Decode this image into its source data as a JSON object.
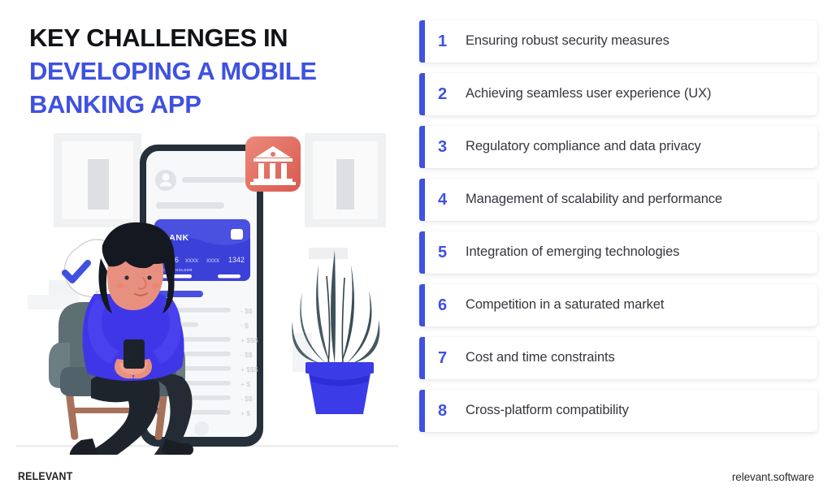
{
  "title": {
    "line1": "KEY CHALLENGES IN",
    "line2": "DEVELOPING A MOBILE",
    "line3": "BANKING APP"
  },
  "colors": {
    "accent_blue": "#3F51E0",
    "title_dark": "#111216",
    "text_gray": "#35373E",
    "card_white": "#FFFFFF",
    "page_bg": "#FFFFFF",
    "bank_icon_red": "#E4766B",
    "plant_pot_blue": "#3B3BE8",
    "sweater_blue": "#3F36E8",
    "chair_gray": "#5E6F74",
    "hair_black": "#141821",
    "skin": "#E8907F"
  },
  "list": [
    {
      "number": "1",
      "text": "Ensuring robust security measures"
    },
    {
      "number": "2",
      "text": "Achieving seamless user experience (UX)"
    },
    {
      "number": "3",
      "text": "Regulatory compliance and data privacy"
    },
    {
      "number": "4",
      "text": "Management of scalability and performance"
    },
    {
      "number": "5",
      "text": "Integration of emerging technologies"
    },
    {
      "number": "6",
      "text": "Competition in a saturated market"
    },
    {
      "number": "7",
      "text": "Cost and time constraints"
    },
    {
      "number": "8",
      "text": "Cross-platform compatibility"
    }
  ],
  "illustration": {
    "bank_card": {
      "brand": "BANK",
      "number_group_1": "4356",
      "number_group_2": "xxxx",
      "number_group_3": "xxxx",
      "number_group_4": "1342",
      "holder_label": "CARD HOLDER"
    },
    "transactions": [
      {
        "dot": "dark",
        "amount": "- $$"
      },
      {
        "dot": "dark",
        "amount": "- $"
      },
      {
        "dot": "blue",
        "amount": "+ $$$"
      },
      {
        "dot": "dark",
        "amount": "- $$"
      },
      {
        "dot": "blue",
        "amount": "+ $$$"
      },
      {
        "dot": "blue",
        "amount": "+ $"
      },
      {
        "dot": "dark",
        "amount": "- $$"
      },
      {
        "dot": "blue",
        "amount": "+ $"
      }
    ],
    "icons": {
      "bank_badge": "bank-building-icon",
      "check_bubble": "check-mark-bubble-icon",
      "avatar": "user-avatar-icon",
      "plant": "potted-aloe-plant",
      "person": "seated-person-with-phone",
      "chair": "armchair",
      "phone": "smartphone-mockup"
    }
  },
  "footer": {
    "brand": "RELEVANT",
    "url": "relevant.software"
  }
}
